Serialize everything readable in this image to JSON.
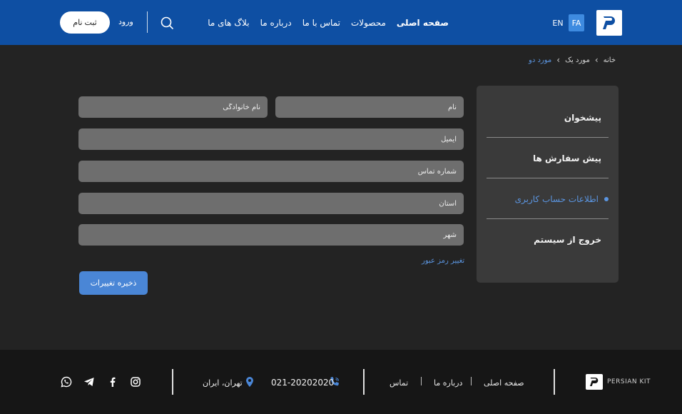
{
  "header": {
    "languages": {
      "fa": "FA",
      "en": "EN"
    },
    "nav": [
      {
        "label": "صفحه اصلی",
        "active": true
      },
      {
        "label": "محصولات",
        "active": false
      },
      {
        "label": "تماس با ما",
        "active": false
      },
      {
        "label": "درباره ما",
        "active": false
      },
      {
        "label": "بلاگ های ما",
        "active": false
      }
    ],
    "login_label": "ورود",
    "signup_label": "ثبت نام",
    "icons": {
      "search": "search-icon",
      "logo": "persian-kit-logo"
    }
  },
  "breadcrumb": [
    {
      "label": "خانه",
      "current": false
    },
    {
      "label": "مورد یک",
      "current": false
    },
    {
      "label": "مورد دو",
      "current": true
    }
  ],
  "sidebar": {
    "items": [
      {
        "label": "پیشخوان",
        "active": false
      },
      {
        "label": "پیش سفارش ها",
        "active": false
      },
      {
        "label": "اطلاعات حساب کاربری",
        "active": true
      },
      {
        "label": "خروج از سیستم",
        "active": false
      }
    ]
  },
  "form": {
    "first_name_placeholder": "نام",
    "last_name_placeholder": "نام خانوادگی",
    "email_placeholder": "ایمیل",
    "phone_placeholder": "شماره تماس",
    "province_placeholder": "استان",
    "city_placeholder": "شهر",
    "change_password_label": "تغییر رمز عبور",
    "save_label": "ذخیره تغییرات"
  },
  "footer": {
    "brand": "PERSIAN KIT",
    "links": [
      "صفحه اصلی",
      "درباره ما",
      "تماس"
    ],
    "phone": "021-20202020",
    "address": "تهران، ایران",
    "social_icons": [
      "instagram-icon",
      "facebook-icon",
      "telegram-icon",
      "whatsapp-icon"
    ]
  },
  "colors": {
    "header_bg": "#0e4fa3",
    "page_bg": "#232323",
    "accent": "#4a86d6",
    "sidebar_bg": "#3a3a3a",
    "input_bg": "#6e6e6e",
    "footer_bg": "#161616"
  }
}
